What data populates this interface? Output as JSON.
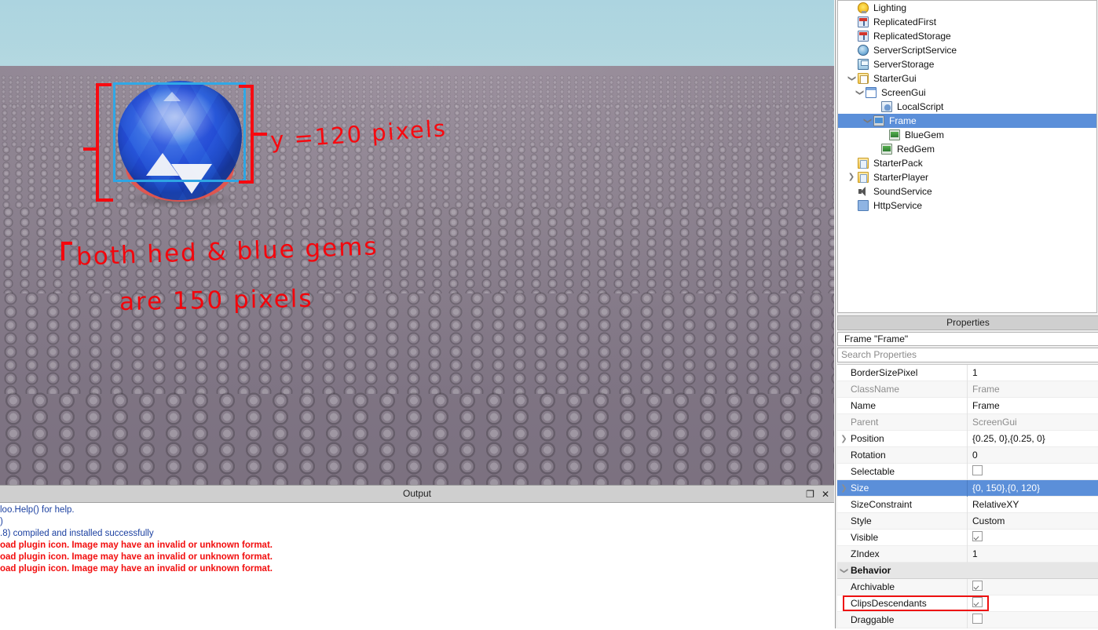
{
  "viewport": {
    "annotations": [
      {
        "id": "y-label",
        "text": "y =120 pixels"
      },
      {
        "id": "gems-line1",
        "text": "both hed & blue  gems"
      },
      {
        "id": "gems-line2",
        "text": "are 150  pixels"
      }
    ],
    "selection_box_label": "Frame selection rectangle",
    "gem_label": "blue-red gem sphere"
  },
  "output": {
    "title": "Output",
    "restore_label": "❐",
    "close_label": "✕",
    "lines": [
      {
        "text": "loo.Help() for help.",
        "type": "info"
      },
      {
        "text": ")",
        "type": "info"
      },
      {
        "text": ".8) compiled and installed successfully",
        "type": "info"
      },
      {
        "text": "oad plugin icon. Image may have an invalid or unknown format.",
        "type": "err"
      },
      {
        "text": "oad plugin icon. Image may have an invalid or unknown format.",
        "type": "err"
      },
      {
        "text": "oad plugin icon. Image may have an invalid or unknown format.",
        "type": "err"
      }
    ]
  },
  "explorer": {
    "items": [
      {
        "label": "Lighting",
        "indent": 1,
        "twist": "",
        "icon": "ic-lighting",
        "selected": false
      },
      {
        "label": "ReplicatedFirst",
        "indent": 1,
        "twist": "",
        "icon": "ic-repl",
        "selected": false
      },
      {
        "label": "ReplicatedStorage",
        "indent": 1,
        "twist": "",
        "icon": "ic-repl",
        "selected": false
      },
      {
        "label": "ServerScriptService",
        "indent": 1,
        "twist": "",
        "icon": "ic-sss",
        "selected": false
      },
      {
        "label": "ServerStorage",
        "indent": 1,
        "twist": "",
        "icon": "ic-sstore",
        "selected": false
      },
      {
        "label": "StarterGui",
        "indent": 1,
        "twist": "v",
        "icon": "ic-folder",
        "selected": false
      },
      {
        "label": "ScreenGui",
        "indent": 2,
        "twist": "v",
        "icon": "ic-screengui",
        "selected": false
      },
      {
        "label": "LocalScript",
        "indent": 4,
        "twist": "",
        "icon": "ic-script",
        "selected": false
      },
      {
        "label": "Frame",
        "indent": 3,
        "twist": "v",
        "icon": "ic-frame",
        "selected": true
      },
      {
        "label": "BlueGem",
        "indent": 5,
        "twist": "",
        "icon": "ic-image",
        "selected": false
      },
      {
        "label": "RedGem",
        "indent": 4,
        "twist": "",
        "icon": "ic-image",
        "selected": false
      },
      {
        "label": "StarterPack",
        "indent": 1,
        "twist": "",
        "icon": "ic-player",
        "selected": false
      },
      {
        "label": "StarterPlayer",
        "indent": 1,
        "twist": ">",
        "icon": "ic-player",
        "selected": false
      },
      {
        "label": "SoundService",
        "indent": 1,
        "twist": "",
        "icon": "ic-sound",
        "selected": false
      },
      {
        "label": "HttpService",
        "indent": 1,
        "twist": "",
        "icon": "ic-http",
        "selected": false
      }
    ]
  },
  "properties": {
    "title": "Properties",
    "object": "Frame \"Frame\"",
    "search_placeholder": "Search Properties",
    "rows": [
      {
        "name": "BorderSizePixel",
        "value": "1",
        "kind": "text",
        "arrow": "",
        "dim": false,
        "selected": false,
        "category": false,
        "highlight": false
      },
      {
        "name": "ClassName",
        "value": "Frame",
        "kind": "text",
        "arrow": "",
        "dim": true,
        "selected": false,
        "category": false,
        "highlight": false
      },
      {
        "name": "Name",
        "value": "Frame",
        "kind": "text",
        "arrow": "",
        "dim": false,
        "selected": false,
        "category": false,
        "highlight": false
      },
      {
        "name": "Parent",
        "value": "ScreenGui",
        "kind": "text",
        "arrow": "",
        "dim": true,
        "selected": false,
        "category": false,
        "highlight": false
      },
      {
        "name": "Position",
        "value": "{0.25, 0},{0.25, 0}",
        "kind": "text",
        "arrow": ">",
        "dim": false,
        "selected": false,
        "category": false,
        "highlight": false
      },
      {
        "name": "Rotation",
        "value": "0",
        "kind": "text",
        "arrow": "",
        "dim": false,
        "selected": false,
        "category": false,
        "highlight": false
      },
      {
        "name": "Selectable",
        "value": "",
        "kind": "checkbox",
        "arrow": "",
        "dim": false,
        "selected": false,
        "category": false,
        "highlight": false,
        "checked": false
      },
      {
        "name": "Size",
        "value": "{0, 150},{0, 120}",
        "kind": "text",
        "arrow": ">",
        "dim": false,
        "selected": true,
        "category": false,
        "highlight": false
      },
      {
        "name": "SizeConstraint",
        "value": "RelativeXY",
        "kind": "text",
        "arrow": "",
        "dim": false,
        "selected": false,
        "category": false,
        "highlight": false
      },
      {
        "name": "Style",
        "value": "Custom",
        "kind": "text",
        "arrow": "",
        "dim": false,
        "selected": false,
        "category": false,
        "highlight": false
      },
      {
        "name": "Visible",
        "value": "",
        "kind": "checkbox",
        "arrow": "",
        "dim": false,
        "selected": false,
        "category": false,
        "highlight": false,
        "checked": true
      },
      {
        "name": "ZIndex",
        "value": "1",
        "kind": "text",
        "arrow": "",
        "dim": false,
        "selected": false,
        "category": false,
        "highlight": false
      },
      {
        "name": "Behavior",
        "value": "",
        "kind": "text",
        "arrow": "v",
        "dim": false,
        "selected": false,
        "category": true,
        "highlight": false
      },
      {
        "name": "Archivable",
        "value": "",
        "kind": "checkbox",
        "arrow": "",
        "dim": false,
        "selected": false,
        "category": false,
        "highlight": false,
        "checked": true
      },
      {
        "name": "ClipsDescendants",
        "value": "",
        "kind": "checkbox",
        "arrow": "",
        "dim": false,
        "selected": false,
        "category": false,
        "highlight": true,
        "checked": true
      },
      {
        "name": "Draggable",
        "value": "",
        "kind": "checkbox",
        "arrow": "",
        "dim": false,
        "selected": false,
        "category": false,
        "highlight": false,
        "checked": false
      }
    ]
  },
  "colors": {
    "selection_blue": "#5b8fd9",
    "annotation_red": "#fb0007",
    "selection_box_cyan": "#27a6e8",
    "error_red": "#f20d0d",
    "info_blue": "#1a3fa0",
    "highlight_red": "#ee1111"
  }
}
